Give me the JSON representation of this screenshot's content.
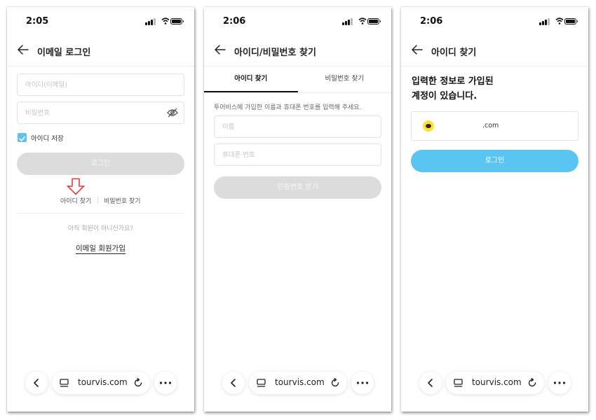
{
  "screens": [
    {
      "time": "2:05",
      "title": "이메일 로그인",
      "id_placeholder": "아이디(이메일)",
      "pw_placeholder": "비밀번호",
      "save_id_label": "아이디 저장",
      "save_id_checked": true,
      "login_label": "로그인",
      "find_id_label": "아이디 찾기",
      "find_pw_label": "비밀번호 찾기",
      "no_member_text": "아직 회원이 아니신가요?",
      "signup_label": "이메일 회원가입"
    },
    {
      "time": "2:06",
      "title": "아이디/비밀번호 찾기",
      "tabs": [
        {
          "label": "아이디 찾기",
          "active": true
        },
        {
          "label": "비밀번호 찾기",
          "active": false
        }
      ],
      "guide_text": "투어비스에 가입한 이름과 휴대폰 번호를 입력해 주세요.",
      "name_placeholder": "이름",
      "phone_placeholder": "휴대폰 번호",
      "verify_label": "인증번호 받기"
    },
    {
      "time": "2:06",
      "title": "아이디 찾기",
      "result_line1": "입력한 정보로 가입된",
      "result_line2": "계정이 있습니다.",
      "account_email": ".com",
      "login_label": "로그인"
    }
  ],
  "browser": {
    "url": "tourvis.com"
  },
  "colors": {
    "accent": "#5bc5f2",
    "disabled": "#dcdcdc",
    "kakao": "#fbe332",
    "annotation": "#e53935"
  }
}
